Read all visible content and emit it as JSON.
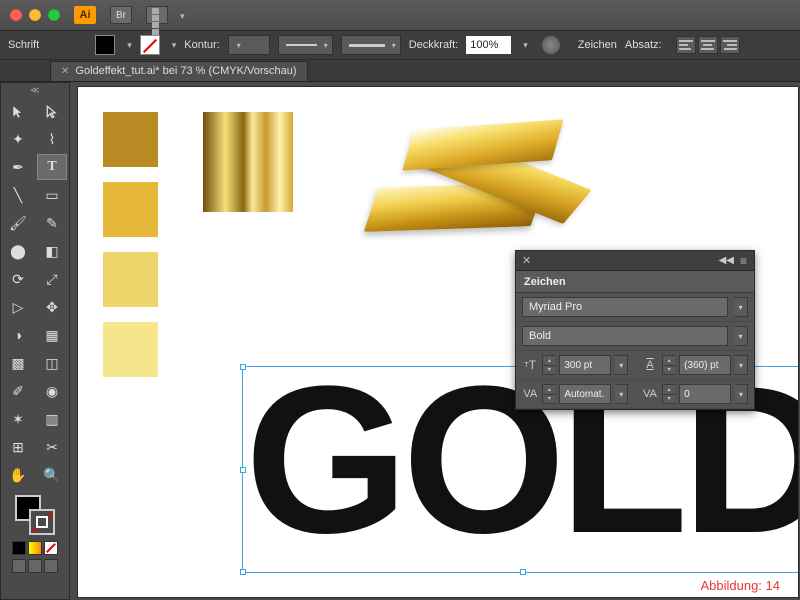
{
  "titlebar": {
    "app_abbrev": "Ai",
    "bridge_label": "Br"
  },
  "ctrlbar": {
    "type_label": "Schrift",
    "stroke_label": "Kontur:",
    "opacity_label": "Deckkraft:",
    "opacity_value": "100%",
    "char_link": "Zeichen",
    "para_link": "Absatz:"
  },
  "tab": {
    "close": "✕",
    "title": "Goldeffekt_tut.ai* bei 73 % (CMYK/Vorschau)"
  },
  "canvas": {
    "big_text": "GOLD",
    "figure_label": "Abbildung: 14",
    "swatch_colors": [
      "#b88a23",
      "#e6b83a",
      "#efd46b",
      "#f7e58c"
    ]
  },
  "panel": {
    "title": "Zeichen",
    "font_family": "Myriad Pro",
    "font_style": "Bold",
    "font_size": "300 pt",
    "leading": "(360) pt",
    "kerning": "Automat.",
    "tracking": "0",
    "icons": {
      "size": "T",
      "leading": "A",
      "kerning": "VA",
      "tracking": "VA"
    }
  },
  "tools": {
    "row_labels": [
      [
        "sel",
        "direct"
      ],
      [
        "wand",
        "lasso"
      ],
      [
        "pen",
        "type"
      ],
      [
        "line",
        "rect"
      ],
      [
        "brush",
        "pencil"
      ],
      [
        "blob",
        "eraser"
      ],
      [
        "rotate",
        "scale"
      ],
      [
        "width",
        "warp"
      ],
      [
        "shape",
        "perspective"
      ],
      [
        "mesh",
        "gradient"
      ],
      [
        "eyedrop",
        "blend"
      ],
      [
        "spray",
        "graph"
      ],
      [
        "artboard",
        "slice"
      ],
      [
        "hand",
        "zoom"
      ]
    ]
  }
}
